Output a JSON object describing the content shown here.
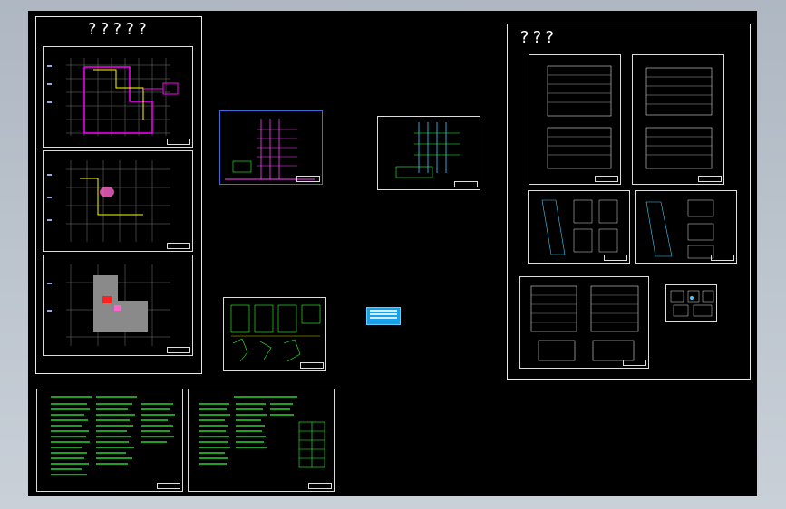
{
  "app": {
    "canvas_color": "#000000",
    "frame_color": "#e8e8e8",
    "bg_color": "#b8c0ca"
  },
  "groups": {
    "left_title": "?????",
    "right_title": "???"
  },
  "colors": {
    "wall": "#ff00ff",
    "pipe": "#ffff00",
    "grid": "#00ff00",
    "dim": "#00ffff",
    "text_green": "#33ff33",
    "legend_blue": "#18a0e8"
  },
  "icons": [
    "legend-swatch-icon"
  ]
}
